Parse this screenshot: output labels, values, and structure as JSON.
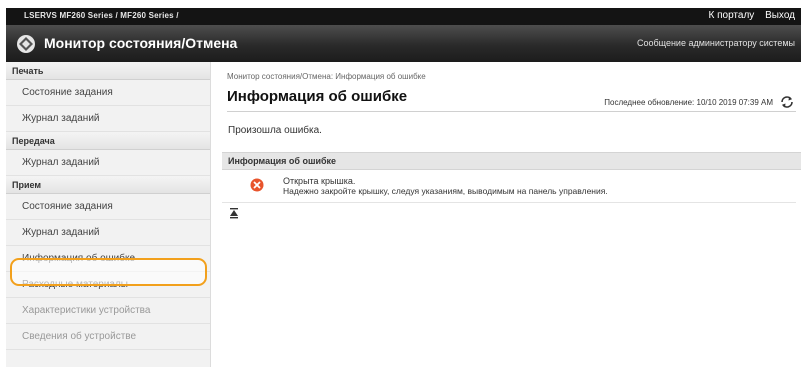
{
  "topbar": {
    "model_text": "LSERVS      MF260 Series / MF260 Series /",
    "portal_link": "К порталу",
    "logout_link": "Выход"
  },
  "header": {
    "title": "Монитор состояния/Отмена",
    "admin_message": "Сообщение администратору системы"
  },
  "sidebar": {
    "sections": [
      {
        "label": "Печать",
        "items": [
          "Состояние задания",
          "Журнал заданий"
        ]
      },
      {
        "label": "Передача",
        "items": [
          "Журнал заданий"
        ]
      },
      {
        "label": "Прием",
        "items": [
          "Состояние задания",
          "Журнал заданий",
          "Информация об ошибке"
        ]
      }
    ],
    "extra_items": [
      "Расходные материалы",
      "Характеристики устройства",
      "Сведения об устройстве"
    ]
  },
  "main": {
    "breadcrumb": "Монитор состояния/Отмена: Информация об ошибке",
    "page_title": "Информация об ошибке",
    "last_updated": "Последнее обновление: 10/10 2019 07:39 AM",
    "summary": "Произошла ошибка.",
    "section_title": "Информация об ошибке",
    "error_title": "Открыта крышка.",
    "error_message": "Надежно закройте крышку, следуя указаниям, выводимым на панель управления."
  },
  "colors": {
    "highlight": "#f2a01c",
    "error_icon": "#e8542c",
    "header_bg": "#2a2a2a"
  },
  "icons": {
    "logo": "monitor-logo-icon",
    "refresh": "refresh-icon",
    "error": "error-x-icon",
    "top": "scroll-top-icon"
  }
}
